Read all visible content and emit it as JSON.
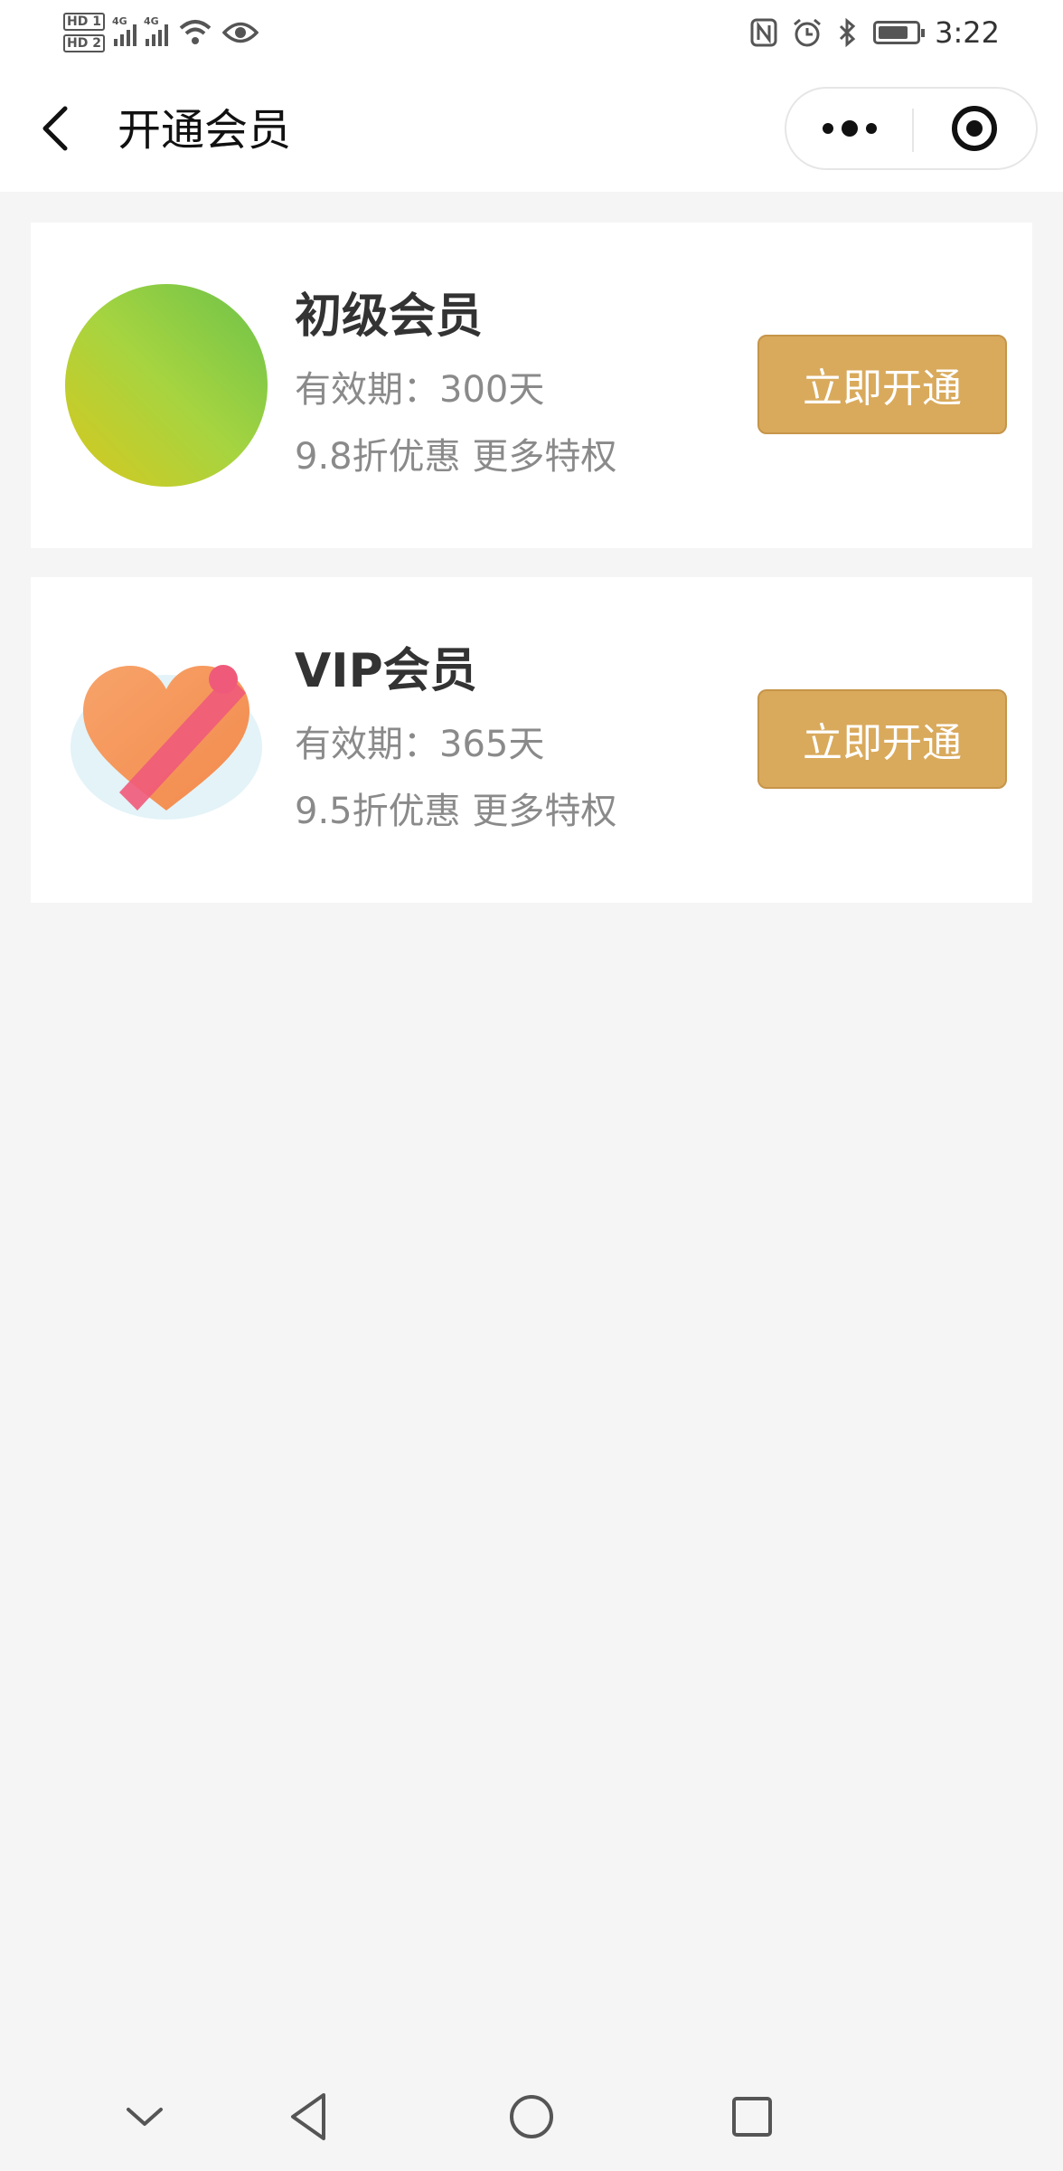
{
  "status_bar": {
    "sim1": "HD 1",
    "sim2": "HD 2",
    "network1": "4G",
    "network2": "4G",
    "time": "3:22",
    "battery_level": 0.8,
    "icons": [
      "signal-icon",
      "wifi-icon",
      "eye-icon",
      "nfc-icon",
      "alarm-icon",
      "bluetooth-icon",
      "battery-icon"
    ]
  },
  "nav": {
    "title": "开通会员",
    "back_icon": "chevron-left-icon",
    "more_icon": "more-dots-icon",
    "close_icon": "target-circle-icon"
  },
  "memberships": [
    {
      "title": "初级会员",
      "validity": "有效期：300天",
      "perks": "9.8折优惠 更多特权",
      "button": "立即开通",
      "image": "green-circle-image"
    },
    {
      "title": "VIP会员",
      "validity": "有效期：365天",
      "perks": "9.5折优惠 更多特权",
      "button": "立即开通",
      "image": "gift-heart-image"
    }
  ],
  "colors": {
    "accent_button": "#d9aa5c",
    "page_background": "#f5f5f5"
  },
  "system_nav": [
    "chevron-down-icon",
    "back-triangle-icon",
    "home-circle-icon",
    "recents-square-icon"
  ]
}
